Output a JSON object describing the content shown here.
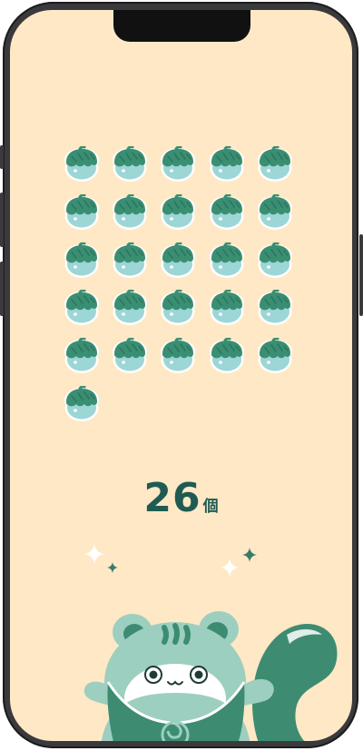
{
  "acorns": {
    "count": 26,
    "icon": "acorn-icon",
    "colors": {
      "cap": "#3a8e72",
      "body": "#9cd6d6",
      "outline": "#ffffff"
    }
  },
  "counter": {
    "value": "26",
    "unit": "個"
  },
  "decorations": {
    "sparkle_color": "#ffffff",
    "small_sparkle_color": "#3a7a68"
  },
  "mascot": {
    "icon": "squirrel-mascot-icon",
    "colors": {
      "fur": "#9ccfc0",
      "dark": "#3d8c72",
      "light": "#ffffff"
    }
  },
  "theme": {
    "background": "#ffe8c6",
    "text": "#1f5b52"
  }
}
